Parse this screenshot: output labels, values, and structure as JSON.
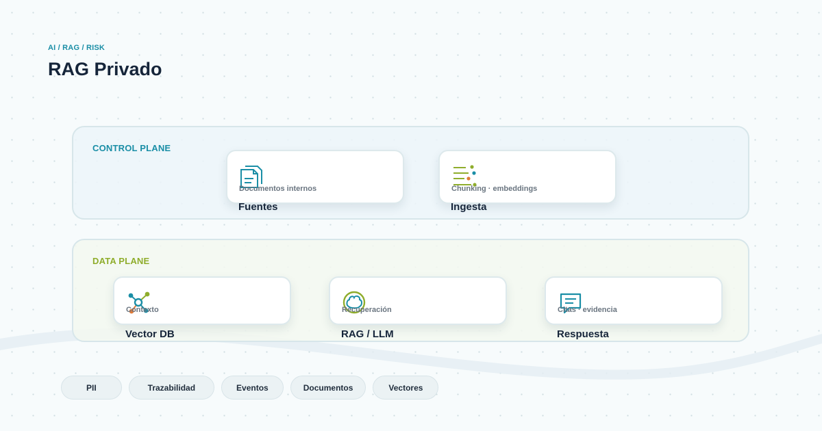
{
  "header": {
    "breadcrumb": "AI / RAG / RISK",
    "title": "RAG Privado"
  },
  "colors": {
    "accent_teal": "#1a8ea6",
    "accent_green": "#8fad2c",
    "text_dark": "#16253a",
    "text_muted": "#6a7580"
  },
  "planes": {
    "control": {
      "label": "CONTROL PLANE",
      "cards": [
        {
          "icon": "document-icon",
          "subtitle": "Documentos internos",
          "title": "Fuentes"
        },
        {
          "icon": "chunking-icon",
          "subtitle": "Chunking · embeddings",
          "title": "Ingesta"
        }
      ]
    },
    "data": {
      "label": "DATA PLANE",
      "cards": [
        {
          "icon": "network-icon",
          "subtitle": "Contexto",
          "title": "Vector DB"
        },
        {
          "icon": "brain-icon",
          "subtitle": "Recuperación",
          "title": "RAG / LLM"
        },
        {
          "icon": "chat-icon",
          "subtitle": "Citas · evidencia",
          "title": "Respuesta"
        }
      ]
    }
  },
  "tags": [
    "PII",
    "Trazabilidad",
    "Eventos",
    "Documentos",
    "Vectores"
  ]
}
